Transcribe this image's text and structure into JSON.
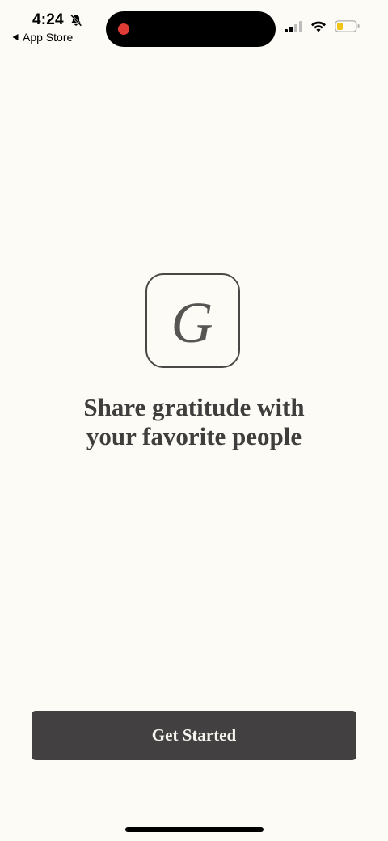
{
  "status_bar": {
    "time": "4:24",
    "back_label": "App Store",
    "record_color": "#e13b35"
  },
  "onboarding": {
    "logo_letter": "G",
    "tagline_line1": "Share gratitude with",
    "tagline_line2": "your favorite people",
    "cta_label": "Get Started"
  },
  "colors": {
    "background": "#fdfbf6",
    "button": "#424040",
    "text": "#3f3e3d"
  },
  "icons": [
    "bell-slash-icon",
    "back-arrow-icon",
    "cellular-signal-icon",
    "wifi-icon",
    "battery-low-icon"
  ]
}
